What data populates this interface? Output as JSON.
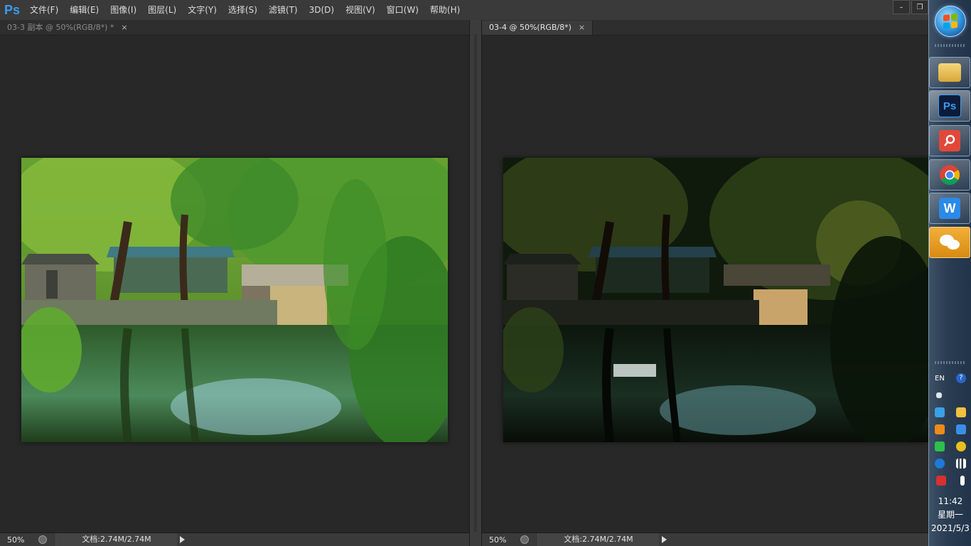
{
  "app": {
    "logo": "Ps"
  },
  "menu": [
    "文件(F)",
    "编辑(E)",
    "图像(I)",
    "图层(L)",
    "文字(Y)",
    "选择(S)",
    "滤镜(T)",
    "3D(D)",
    "视图(V)",
    "窗口(W)",
    "帮助(H)"
  ],
  "window_controls": {
    "minimize": "–",
    "restore": "❐"
  },
  "documents": [
    {
      "tab_title": "03-3 副本 @ 50%(RGB/8*) *",
      "tab_close": "×",
      "zoom": "50%",
      "doc_size": "文档:2.74M/2.74M",
      "image_description_icon": "photo-willow-bridge-bright"
    },
    {
      "tab_title": "03-4 @ 50%(RGB/8*)",
      "tab_close": "×",
      "zoom": "50%",
      "doc_size": "文档:2.74M/2.74M",
      "image_description_icon": "photo-willow-bridge-dark"
    }
  ],
  "taskbar": {
    "apps": [
      {
        "name": "file-explorer-icon"
      },
      {
        "name": "photoshop-icon",
        "label": "Ps"
      },
      {
        "name": "wps-pdf-icon"
      },
      {
        "name": "chrome-icon"
      },
      {
        "name": "wps-writer-icon",
        "label": "W"
      },
      {
        "name": "wechat-icon"
      }
    ],
    "tray": {
      "lang": "EN",
      "help": "?"
    },
    "clock": {
      "time": "11:42",
      "weekday": "星期一",
      "date": "2021/5/3"
    }
  },
  "colors": {
    "ps_blue": "#3b9bf0",
    "wechat_orange": "#e89c22"
  }
}
